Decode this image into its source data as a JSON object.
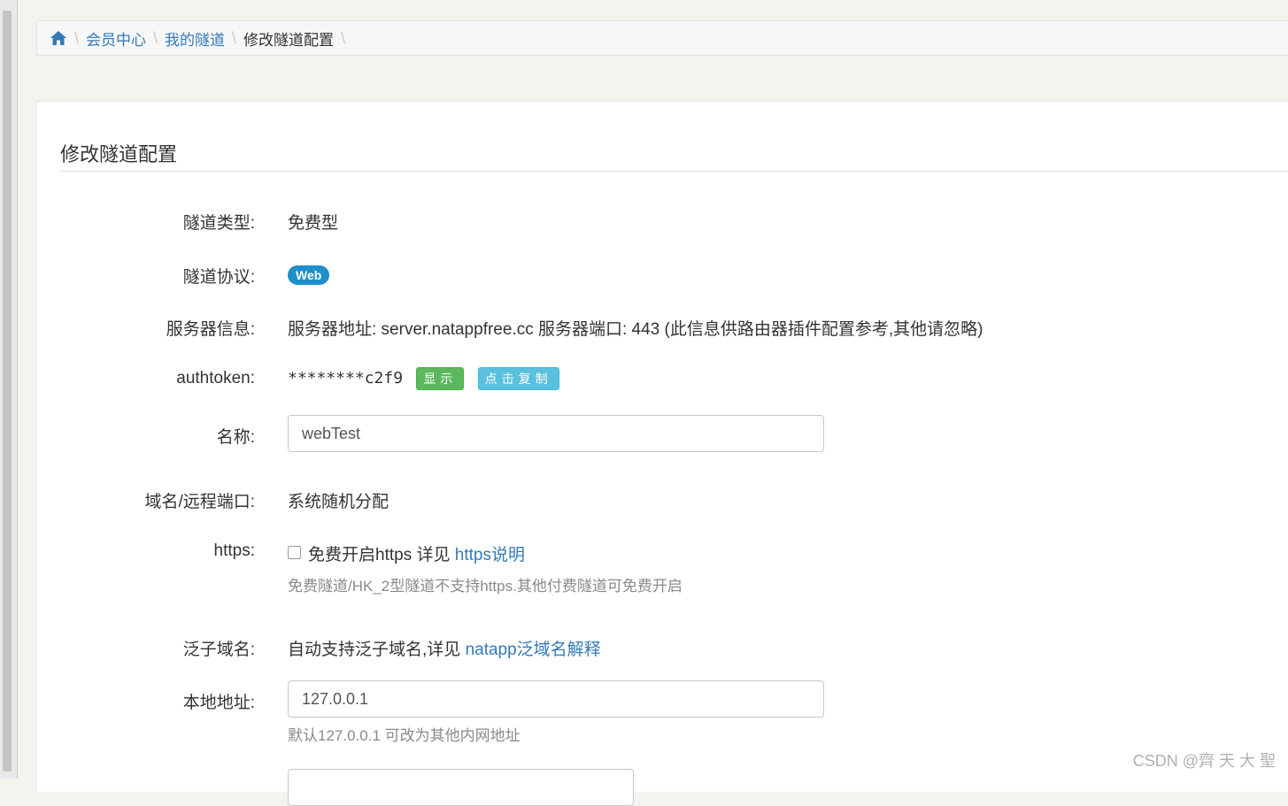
{
  "breadcrumb": {
    "home_icon": "home-icon",
    "items": [
      "会员中心",
      "我的隧道",
      "修改隧道配置"
    ]
  },
  "panel": {
    "title": "修改隧道配置"
  },
  "form": {
    "type_label": "隧道类型:",
    "type_value": "免费型",
    "protocol_label": "隧道协议:",
    "protocol_badge": "Web",
    "server_label": "服务器信息:",
    "server_value": "服务器地址: server.natappfree.cc 服务器端口: 443 (此信息供路由器插件配置参考,其他请忽略)",
    "authtoken_label": "authtoken:",
    "authtoken_value": "********c2f9",
    "show_button": "显示",
    "copy_button": "点击复制",
    "name_label": "名称:",
    "name_value": "webTest",
    "domain_label": "域名/远程端口:",
    "domain_value": "系统随机分配",
    "https_label": "https:",
    "https_checkbox_text": "免费开启https 详见",
    "https_link": "https说明",
    "https_help": "免费隧道/HK_2型隧道不支持https.其他付费隧道可免费开启",
    "wildcard_label": "泛子域名:",
    "wildcard_text": "自动支持泛子域名,详见",
    "wildcard_link": "natapp泛域名解释",
    "local_label": "本地地址:",
    "local_value": "127.0.0.1",
    "local_help": "默认127.0.0.1 可改为其他内网地址"
  },
  "colors": {
    "link": "#337ab7",
    "badge": "#1f8ecd",
    "green": "#5cb85c",
    "blue": "#5bc0de"
  },
  "watermark": "CSDN @齊 天 大 聖"
}
